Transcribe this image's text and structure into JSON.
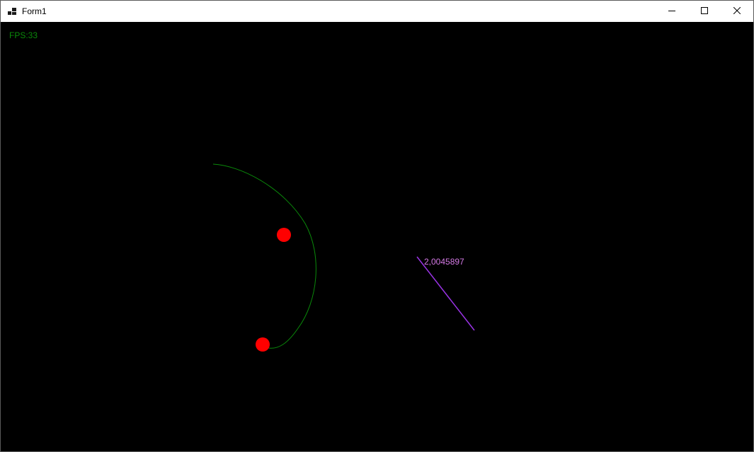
{
  "window": {
    "title": "Form1"
  },
  "titlebar": {
    "icons": {
      "app": "app-icon",
      "minimize": "minimize-icon",
      "maximize": "maximize-icon",
      "close": "close-icon"
    }
  },
  "scene": {
    "fps_text": "FPS:33",
    "value_text": "2,0045897",
    "colors": {
      "background": "#000000",
      "fps_text": "#0a8a0a",
      "arc": "#0a8a0a",
      "balls": "#ff0000",
      "vector_line": "#9a33e6",
      "value_text": "#d57ae6"
    }
  }
}
